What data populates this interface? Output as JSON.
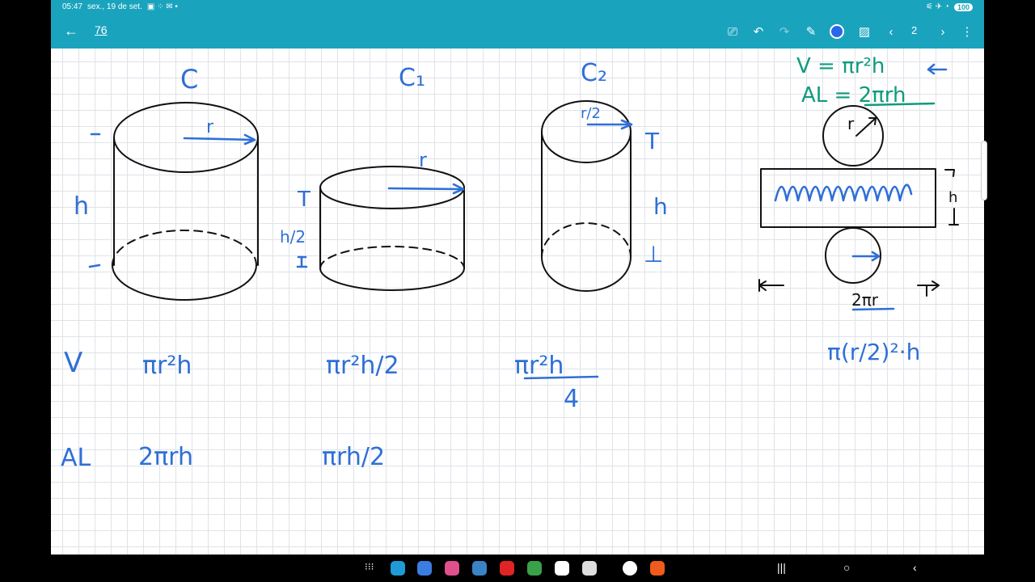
{
  "status": {
    "time": "05:47",
    "date": "sex., 19 de set.",
    "battery": "100"
  },
  "toolbar": {
    "page_title": "76",
    "page_number": "2"
  },
  "cylinders": [
    {
      "label": "C",
      "top_label": "r",
      "side_label": "h"
    },
    {
      "label": "C1",
      "top_label": "r",
      "side_label": "h/2"
    },
    {
      "label": "C2",
      "top_label": "r/2",
      "side_label": "h"
    }
  ],
  "formulas": {
    "v_label": "V",
    "al_label": "AL",
    "v_c": "πr²h",
    "v_c1": "πr²h/2",
    "v_c2_num": "πr²h",
    "v_c2_den": "4",
    "al_c": "2πrh",
    "al_c1": "πrh/2",
    "right_v": "V = πr²h",
    "right_al": "AL = 2πrh",
    "net_r": "r",
    "net_h": "h",
    "net_circumference": "2πr",
    "right_v_c2": "π(r/2)²·h"
  },
  "colors": {
    "bar": "#1aa3bd",
    "pen_blue": "#2f6fd6",
    "pen_green": "#109b7c"
  },
  "icons": [
    "back-arrow-icon",
    "cast-icon",
    "undo-icon",
    "redo-icon",
    "pen-icon",
    "image-icon",
    "chevron-left-icon",
    "chevron-right-icon",
    "more-vert-icon"
  ]
}
